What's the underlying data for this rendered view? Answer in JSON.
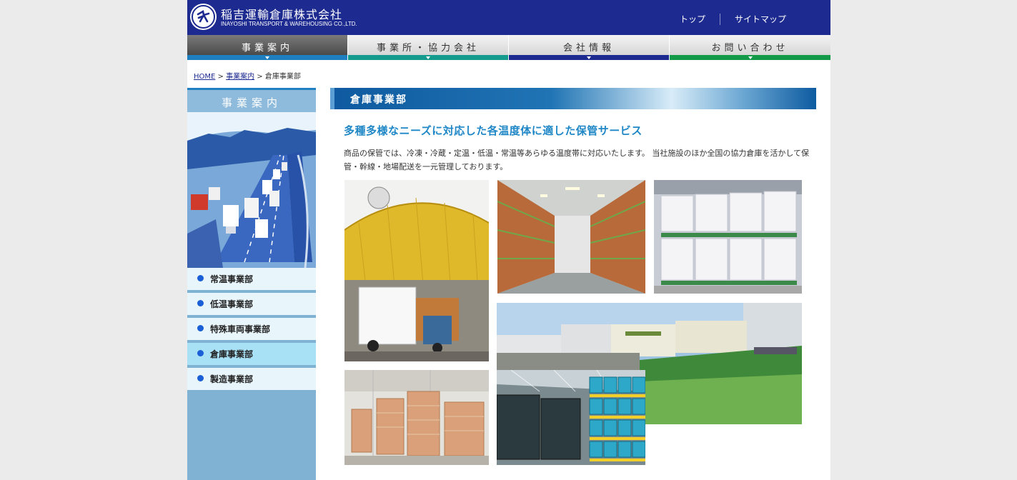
{
  "header": {
    "company_jp": "稲吉運輸倉庫株式会社",
    "company_en": "INAYOSHI TRANSPORT & WAREHOUSING CO.,LTD.",
    "links": [
      "トップ",
      "サイトマップ"
    ]
  },
  "nav": {
    "items": [
      {
        "label": "事業案内",
        "color": "#1d7fbf"
      },
      {
        "label": "事業所・協力会社",
        "color": "#159a8e"
      },
      {
        "label": "会社情報",
        "color": "#1d2a8f"
      },
      {
        "label": "お問い合わせ",
        "color": "#139a48"
      }
    ]
  },
  "breadcrumb": {
    "home": "HOME",
    "sep": ">",
    "section": "事業案内",
    "current": "倉庫事業部"
  },
  "sidebar": {
    "title": "事業案内",
    "items": [
      "常温事業部",
      "低温事業部",
      "特殊車両事業部",
      "倉庫事業部",
      "製造事業部"
    ]
  },
  "main": {
    "section_title": "倉庫事業部",
    "subtitle": "多種多様なニーズに対応した各温度体に適した保管サービス",
    "intro": "商品の保管では、冷凍・冷蔵・定温・低温・常温等あらゆる温度帯に対応いたします。 当社施設のほか全国の協力倉庫を活かして保管・幹線・地場配送を一元管理しております。"
  },
  "colors": {
    "header_bg": "#1d2a8f",
    "accent_blue": "#1f87c6",
    "sidebar_bg": "#80b3d3"
  }
}
